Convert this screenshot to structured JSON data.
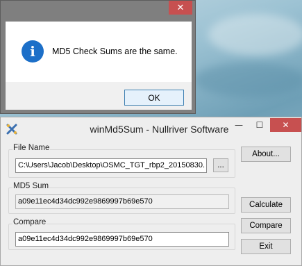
{
  "dialog": {
    "close_glyph": "✕",
    "message": "MD5 Check Sums are the same.",
    "icon": "info-icon",
    "icon_glyph": "i",
    "ok_label": "OK"
  },
  "app": {
    "title": "winMd5Sum - Nullriver Software",
    "controls": {
      "minimize": "—",
      "maximize": "☐",
      "close": "✕"
    },
    "file_name": {
      "label": "File Name",
      "value": "C:\\Users\\Jacob\\Desktop\\OSMC_TGT_rbp2_20150830.",
      "browse_label": "..."
    },
    "md5_sum": {
      "label": "MD5 Sum",
      "value": "a09e11ec4d34dc992e9869997b69e570"
    },
    "compare": {
      "label": "Compare",
      "value": "a09e11ec4d34dc992e9869997b69e570"
    },
    "buttons": {
      "about": "About...",
      "calculate": "Calculate",
      "compare": "Compare",
      "exit": "Exit"
    }
  }
}
